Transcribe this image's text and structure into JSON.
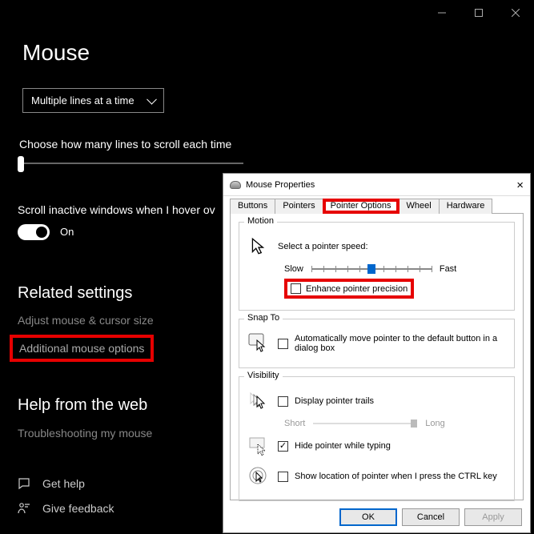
{
  "settings": {
    "title": "Mouse",
    "dropdown": "Multiple lines at a time",
    "scroll_lines_label": "Choose how many lines to scroll each time",
    "scroll_inactive_label": "Scroll inactive windows when I hover ov",
    "toggle_on": "On",
    "related_heading": "Related settings",
    "adjust_link": "Adjust mouse & cursor size",
    "additional_link": "Additional mouse options",
    "help_heading": "Help from the web",
    "troubleshoot_link": "Troubleshooting my mouse",
    "get_help": "Get help",
    "give_feedback": "Give feedback"
  },
  "dialog": {
    "title": "Mouse Properties",
    "tabs": {
      "buttons": "Buttons",
      "pointers": "Pointers",
      "pointer_options": "Pointer Options",
      "wheel": "Wheel",
      "hardware": "Hardware"
    },
    "motion": {
      "legend": "Motion",
      "select_speed": "Select a pointer speed:",
      "slow": "Slow",
      "fast": "Fast",
      "enhance": "Enhance pointer precision"
    },
    "snapto": {
      "legend": "Snap To",
      "text": "Automatically move pointer to the default button in a dialog box"
    },
    "visibility": {
      "legend": "Visibility",
      "trails": "Display pointer trails",
      "short": "Short",
      "long": "Long",
      "hide": "Hide pointer while typing",
      "ctrl": "Show location of pointer when I press the CTRL key"
    },
    "buttons_row": {
      "ok": "OK",
      "cancel": "Cancel",
      "apply": "Apply"
    }
  }
}
